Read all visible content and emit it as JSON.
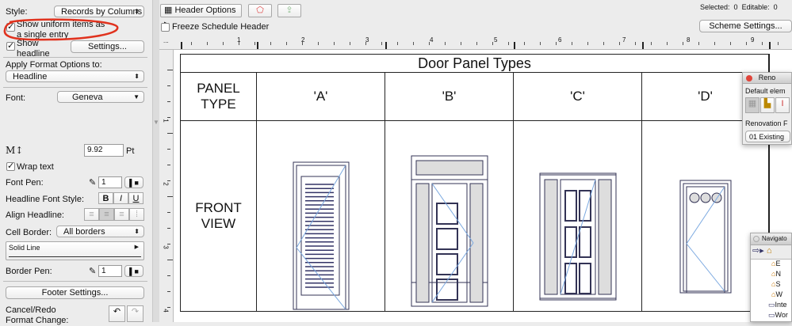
{
  "left_panel": {
    "style_label": "Style:",
    "style_value": "Records by Columns",
    "uniform_label": "Show uniform items as a single entry",
    "headline_label": "Show headline",
    "settings_button": "Settings...",
    "apply_label": "Apply Format Options to:",
    "apply_value": "Headline",
    "font_label": "Font:",
    "font_value": "Geneva",
    "size_value": "9.92",
    "size_unit": "Pt",
    "wrap_label": "Wrap text",
    "font_pen_label": "Font Pen:",
    "font_pen_value": "1",
    "font_style_label": "Headline Font Style:",
    "bold": "B",
    "italic": "I",
    "underline": "U",
    "align_label": "Align Headline:",
    "cell_border_label": "Cell Border:",
    "cell_border_value": "All borders",
    "line_type": "Solid Line",
    "border_pen_label": "Border Pen:",
    "border_pen_value": "1",
    "footer_button": "Footer Settings...",
    "cancel_redo_label": "Cancel/Redo Format Change:"
  },
  "toolbar": {
    "header_options": "Header Options",
    "freeze_label": "Freeze Schedule Header",
    "selected_label": "Selected:",
    "selected_value": "0",
    "editable_label": "Editable:",
    "editable_value": "0",
    "scheme_button": "Scheme Settings..."
  },
  "ruler": {
    "marks": [
      "1",
      "2",
      "3",
      "4",
      "5",
      "6",
      "7",
      "8",
      "9"
    ],
    "v_marks": [
      "1",
      "2",
      "3",
      "4"
    ],
    "corner": "..."
  },
  "schedule": {
    "title": "Door Panel Types",
    "row_header_1": "PANEL TYPE",
    "row_header_2": "FRONT VIEW",
    "columns": [
      "'A'",
      "'B'",
      "'C'",
      "'D'"
    ]
  },
  "renovation": {
    "title": "Reno",
    "default_label": "Default elem",
    "filter_label": "Renovation F",
    "filter_value": "01 Existing"
  },
  "navigator": {
    "title": "Navigato",
    "items": [
      "E",
      "N",
      "S",
      "W",
      "Inte",
      "Wor"
    ]
  }
}
